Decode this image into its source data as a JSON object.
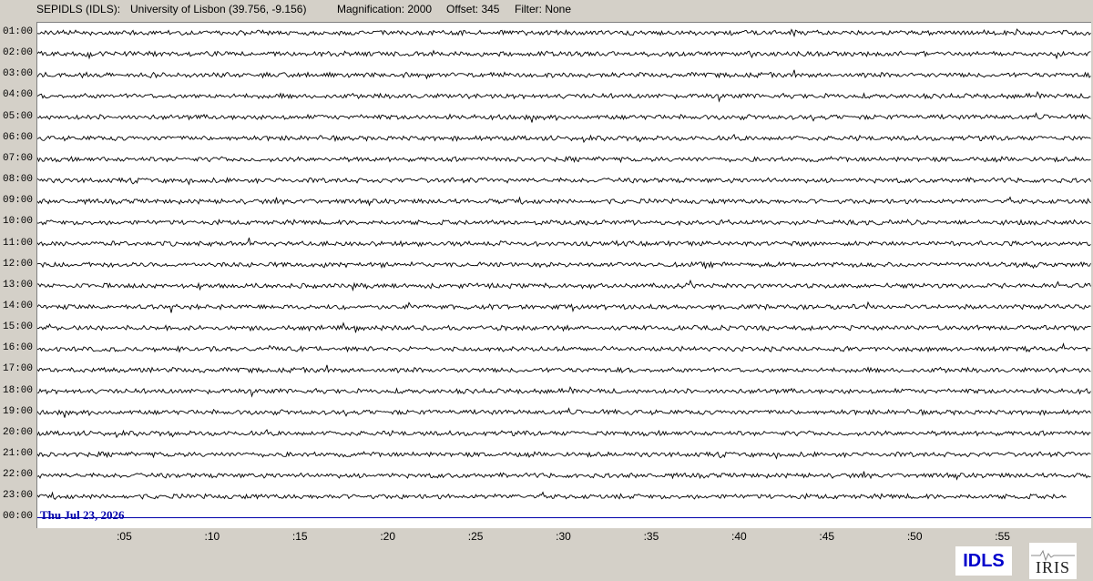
{
  "header": {
    "station": "SEPIDLS (IDLS):",
    "location": "University of Lisbon (39.756, -9.156)",
    "magnification": "Magnification: 2000",
    "offset": "Offset: 345",
    "filter": "Filter: None"
  },
  "hour_labels": [
    "01:00",
    "02:00",
    "03:00",
    "04:00",
    "05:00",
    "06:00",
    "07:00",
    "08:00",
    "09:00",
    "10:00",
    "11:00",
    "12:00",
    "13:00",
    "14:00",
    "15:00",
    "16:00",
    "17:00",
    "18:00",
    "19:00",
    "20:00",
    "21:00",
    "22:00",
    "23:00",
    "00:00"
  ],
  "minute_labels": [
    ":05",
    ":10",
    ":15",
    ":20",
    ":25",
    ":30",
    ":35",
    ":40",
    ":45",
    ":50",
    ":55"
  ],
  "date_label": "Thu Jul 23, 2026",
  "trace_color": "#000000",
  "current_trace_color": "#0000aa",
  "date_color": "#0000aa",
  "logos": {
    "idls": "IDLS",
    "iris": "IRIS"
  }
}
